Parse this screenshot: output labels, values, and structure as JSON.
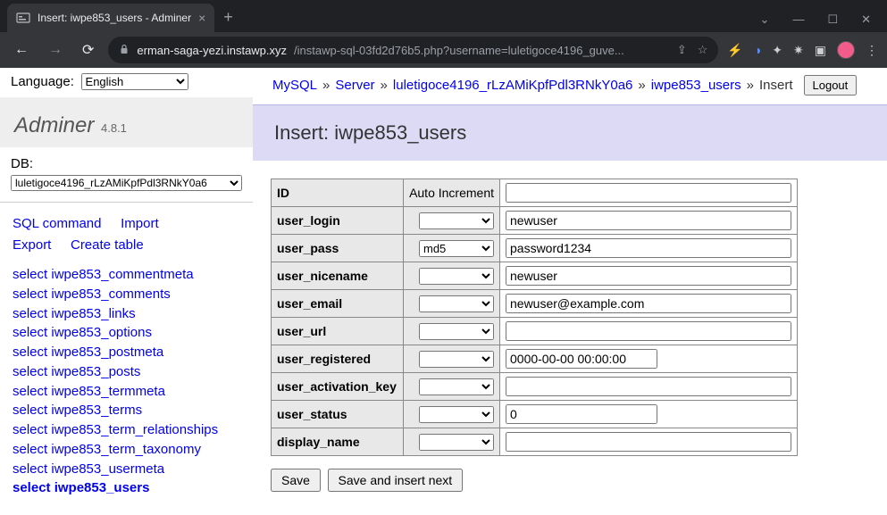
{
  "browser": {
    "tab_title": "Insert: iwpe853_users - Adminer",
    "url_domain": "erman-saga-yezi.instawp.xyz",
    "url_path": "/instawp-sql-03fd2d76b5.php?username=luletigoce4196_guve..."
  },
  "language_label": "Language:",
  "language_value": "English",
  "brand": {
    "name": "Adminer",
    "version": "4.8.1"
  },
  "db_label": "DB:",
  "db_value": "luletigoce4196_rLzAMiKpfPdl3RNkY0a6",
  "side_links": {
    "sql_command": "SQL command",
    "import": "Import",
    "export": "Export",
    "create_table": "Create table"
  },
  "tables": [
    "iwpe853_commentmeta",
    "iwpe853_comments",
    "iwpe853_links",
    "iwpe853_options",
    "iwpe853_postmeta",
    "iwpe853_posts",
    "iwpe853_termmeta",
    "iwpe853_terms",
    "iwpe853_term_relationships",
    "iwpe853_term_taxonomy",
    "iwpe853_usermeta",
    "iwpe853_users"
  ],
  "table_select_prefix": "select",
  "active_table_index": 11,
  "breadcrumbs": {
    "engine": "MySQL",
    "server": "Server",
    "db": "luletigoce4196_rLzAMiKpfPdl3RNkY0a6",
    "table": "iwpe853_users",
    "action": "Insert",
    "logout": "Logout"
  },
  "page_title": "Insert: iwpe853_users",
  "auto_increment_label": "Auto Increment",
  "fields": [
    {
      "name": "ID",
      "func": "",
      "value": "",
      "auto": true,
      "short": false
    },
    {
      "name": "user_login",
      "func": "",
      "value": "newuser",
      "auto": false,
      "short": false
    },
    {
      "name": "user_pass",
      "func": "md5",
      "value": "password1234",
      "auto": false,
      "short": false
    },
    {
      "name": "user_nicename",
      "func": "",
      "value": "newuser",
      "auto": false,
      "short": false
    },
    {
      "name": "user_email",
      "func": "",
      "value": "newuser@example.com",
      "auto": false,
      "short": false
    },
    {
      "name": "user_url",
      "func": "",
      "value": "",
      "auto": false,
      "short": false
    },
    {
      "name": "user_registered",
      "func": "",
      "value": "0000-00-00 00:00:00",
      "auto": false,
      "short": true
    },
    {
      "name": "user_activation_key",
      "func": "",
      "value": "",
      "auto": false,
      "short": false
    },
    {
      "name": "user_status",
      "func": "",
      "value": "0",
      "auto": false,
      "short": true
    },
    {
      "name": "display_name",
      "func": "",
      "value": "",
      "auto": false,
      "short": false
    }
  ],
  "buttons": {
    "save": "Save",
    "save_next": "Save and insert next"
  }
}
